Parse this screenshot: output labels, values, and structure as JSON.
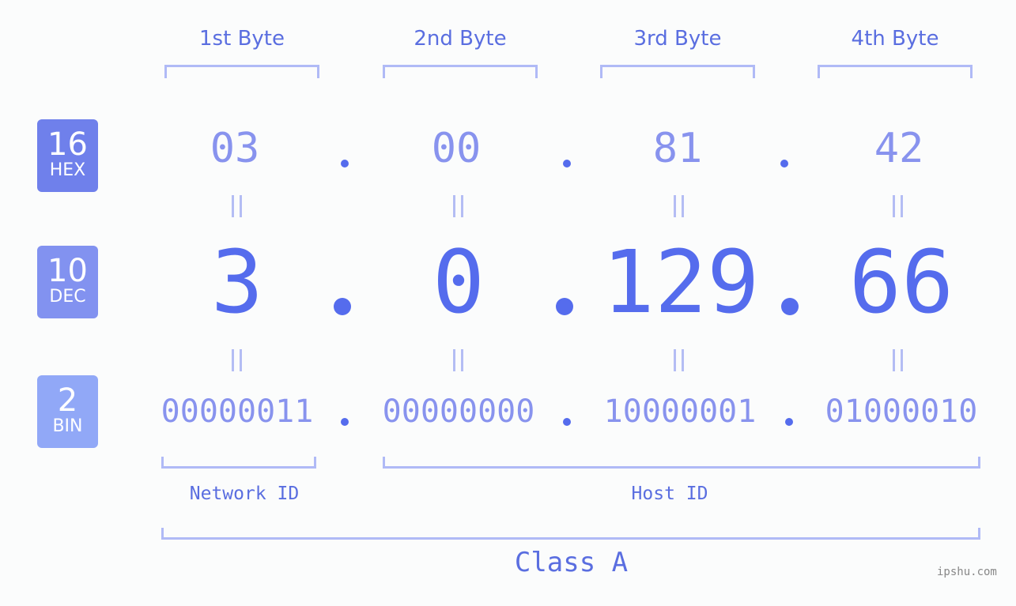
{
  "byte_headers": [
    "1st Byte",
    "2nd Byte",
    "3rd Byte",
    "4th Byte"
  ],
  "rows": {
    "hex": {
      "base": "16",
      "label": "HEX",
      "color": "#6f80eb",
      "octets": [
        "03",
        "00",
        "81",
        "42"
      ]
    },
    "dec": {
      "base": "10",
      "label": "DEC",
      "color": "#8292f0",
      "octets": [
        "3",
        "0",
        "129",
        "66"
      ]
    },
    "bin": {
      "base": "2",
      "label": "BIN",
      "color": "#91a8f7",
      "octets": [
        "00000011",
        "00000000",
        "10000001",
        "01000010"
      ]
    }
  },
  "separator": ".",
  "network_id_label": "Network ID",
  "host_id_label": "Host ID",
  "class_label": "Class A",
  "watermark": "ipshu.com"
}
